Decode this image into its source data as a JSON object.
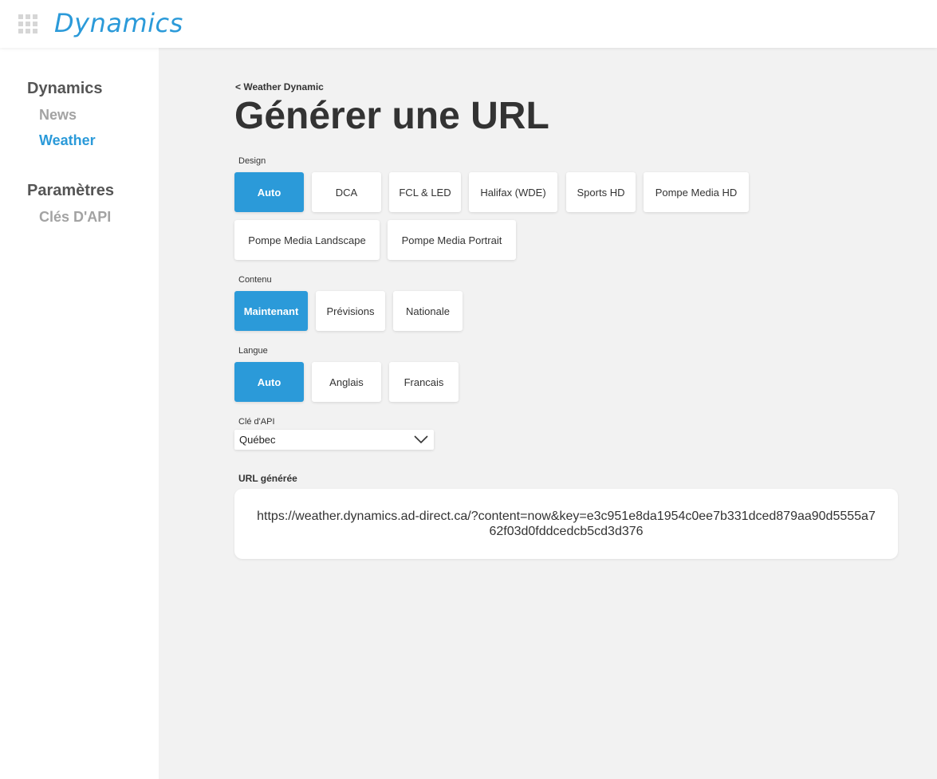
{
  "app": {
    "logo_text": "Dynamics",
    "accent_color": "#2b9ad9"
  },
  "sidebar": {
    "sections": [
      {
        "title": "Dynamics",
        "items": [
          {
            "label": "News",
            "active": false
          },
          {
            "label": "Weather",
            "active": true
          }
        ]
      },
      {
        "title": "Paramètres",
        "items": [
          {
            "label": "Clés D'API",
            "active": false
          }
        ]
      }
    ]
  },
  "header": {
    "back_label": "< Weather Dynamic",
    "title": "Générer une URL"
  },
  "design": {
    "label": "Design",
    "options": [
      "Auto",
      "DCA",
      "FCL & LED",
      "Halifax (WDE)",
      "Sports HD",
      "Pompe Media HD",
      "Pompe Media Landscape",
      "Pompe Media Portrait"
    ],
    "selected": "Auto"
  },
  "contenu": {
    "label": "Contenu",
    "options": [
      "Maintenant",
      "Prévisions",
      "Nationale"
    ],
    "selected": "Maintenant"
  },
  "langue": {
    "label": "Langue",
    "options": [
      "Auto",
      "Anglais",
      "Francais"
    ],
    "selected": "Auto"
  },
  "api_key": {
    "label": "Clé d'API",
    "value": "Québec",
    "icon": "chevron-down-icon"
  },
  "generated_url": {
    "label": "URL générée",
    "value": "https://weather.dynamics.ad-direct.ca/?content=now&key=e3c951e8da1954c0ee7b331dced879aa90d5555a762f03d0fddcedcb5cd3d376"
  }
}
